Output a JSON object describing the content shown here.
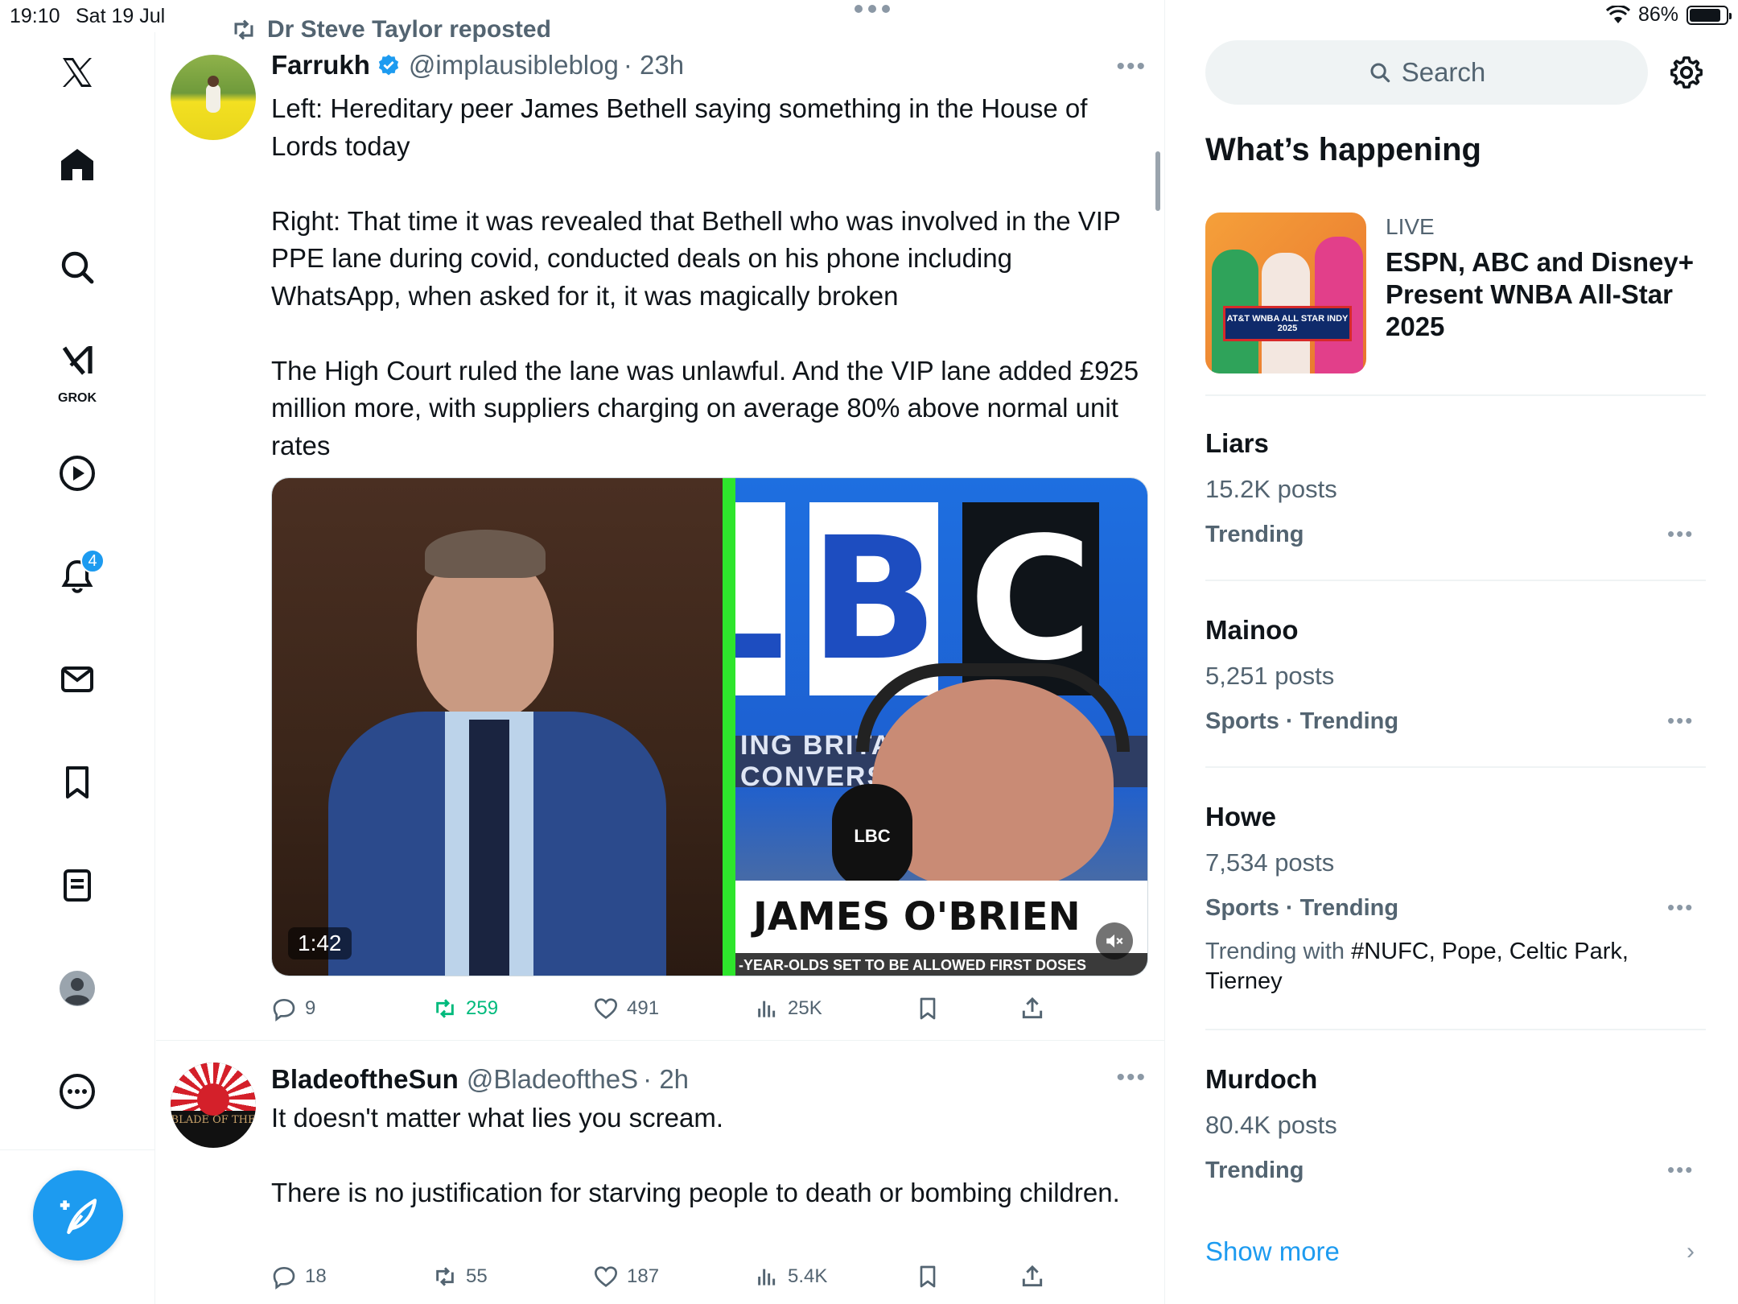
{
  "status_bar": {
    "time": "19:10",
    "date": "Sat 19 Jul",
    "battery": "86%",
    "battery_level": 0.86
  },
  "nav": {
    "grok_label": "GROK",
    "notifications_badge": "4",
    "icons": [
      "x-logo-icon",
      "home-icon",
      "search-icon",
      "grok-icon",
      "video-icon",
      "bell-icon",
      "mail-icon",
      "bookmark-icon",
      "lists-icon",
      "profile-icon",
      "more-icon",
      "compose-icon"
    ]
  },
  "timeline": {
    "posts": [
      {
        "repost_by": "Dr Steve Taylor reposted",
        "name": "Farrukh",
        "handle": "@implausibleblog",
        "time": "· 23h",
        "verified": true,
        "text": "Left: Hereditary peer James Bethell saying something in the House of Lords today\n\nRight: That time it was revealed that Bethell who was involved in the VIP PPE lane during covid, conducted deals on his phone including WhatsApp, when asked for it, it was magically broken\n\nThe High Court ruled the lane was unlawful. And the VIP lane added £925 million more, with suppliers charging on average 80% above normal unit rates",
        "media": {
          "duration": "1:42",
          "lbc_letters": [
            "L",
            "B",
            "C"
          ],
          "lbc_banner": "ING BRITAIN'S CONVERSATION",
          "lbc_name": "JAMES O'BRIEN",
          "lbc_ticker": "-YEAR-OLDS SET TO BE ALLOWED FIRST DOSES",
          "mic_label": "LBC"
        },
        "replies": "9",
        "reposts": "259",
        "likes": "491",
        "views": "25K"
      },
      {
        "name": "BladeoftheSun",
        "handle": "@BladeoftheS",
        "time": "· 2h",
        "verified": false,
        "avatar_text": "BLADE OF THE",
        "text": "It doesn't matter what lies you scream.\n\nThere is no justification for starving people to death or bombing children.",
        "replies": "18",
        "reposts": "55",
        "likes": "187",
        "views": "5.4K"
      }
    ]
  },
  "sidebar": {
    "search_placeholder": "Search",
    "section_title": "What’s happening",
    "live": {
      "label": "LIVE",
      "title": "ESPN, ABC and Disney+ Present WNBA All-Star 2025",
      "thumb_text": "AT&T WNBA ALL STAR INDY 2025"
    },
    "trends": [
      {
        "name": "Liars",
        "count": "15.2K posts",
        "category": "Trending"
      },
      {
        "name": "Mainoo",
        "count": "5,251 posts",
        "category": "Sports · Trending"
      },
      {
        "name": "Howe",
        "count": "7,534 posts",
        "category": "Sports · Trending",
        "with_prefix": "Trending with ",
        "with": "#NUFC, Pope, Celtic Park, Tierney"
      },
      {
        "name": "Murdoch",
        "count": "80.4K posts",
        "category": "Trending"
      }
    ],
    "show_more": "Show more"
  },
  "colors": {
    "accent": "#1d9bf0",
    "repost_green": "#00ba7c",
    "muted": "#536471",
    "text": "#0f1419"
  }
}
